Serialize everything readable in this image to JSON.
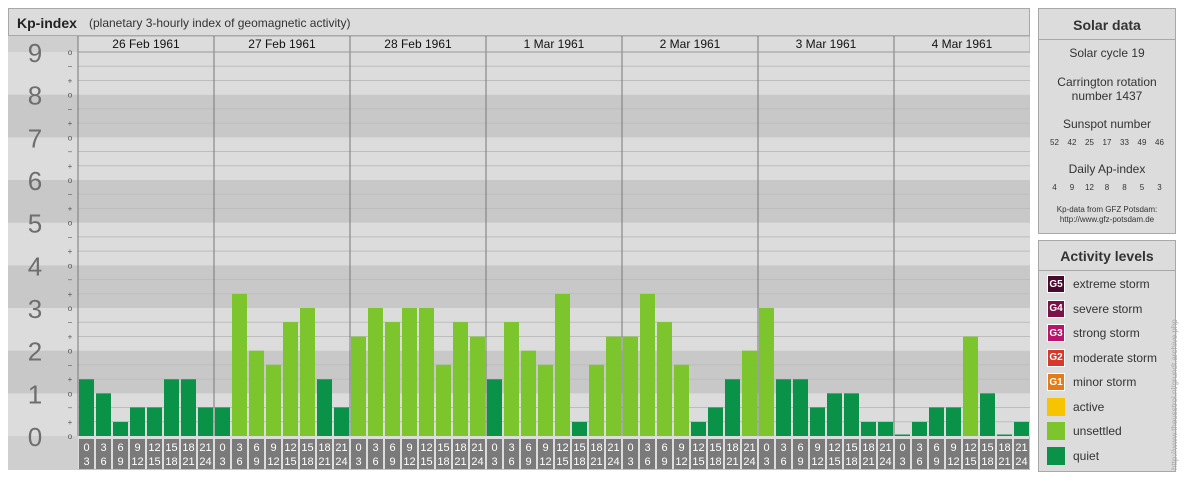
{
  "header": {
    "title": "Kp-index",
    "subtitle": "(planetary 3-hourly index of geomagnetic activity)"
  },
  "chart_data": {
    "type": "bar",
    "title": "Kp-index",
    "subtitle": "(planetary 3-hourly index of geomagnetic activity)",
    "ylim": [
      0,
      9
    ],
    "y_ticks": [
      "0",
      "1",
      "2",
      "3",
      "4",
      "5",
      "6",
      "7",
      "8",
      "9"
    ],
    "sub_ticks": [
      "+",
      "o",
      "−"
    ],
    "days": [
      "26 Feb 1961",
      "27 Feb 1961",
      "28 Feb 1961",
      "1 Mar 1961",
      "2 Mar 1961",
      "3 Mar 1961",
      "4 Mar 1961"
    ],
    "slots": [
      [
        "0",
        "3"
      ],
      [
        "3",
        "6"
      ],
      [
        "6",
        "9"
      ],
      [
        "9",
        "12"
      ],
      [
        "12",
        "15"
      ],
      [
        "15",
        "18"
      ],
      [
        "18",
        "21"
      ],
      [
        "21",
        "24"
      ]
    ],
    "values": [
      [
        1.33,
        1.0,
        0.33,
        0.67,
        0.67,
        1.33,
        1.33,
        0.67
      ],
      [
        0.67,
        3.33,
        2.0,
        1.67,
        2.67,
        3.0,
        1.33,
        0.67
      ],
      [
        2.33,
        3.0,
        2.67,
        3.0,
        3.0,
        1.67,
        2.67,
        2.33
      ],
      [
        1.33,
        2.67,
        2.0,
        1.67,
        3.33,
        0.33,
        1.67,
        2.33
      ],
      [
        2.33,
        3.33,
        2.67,
        1.67,
        0.33,
        0.67,
        1.33,
        2.0
      ],
      [
        3.0,
        1.33,
        1.33,
        0.67,
        1.0,
        1.0,
        0.33,
        0.33
      ],
      [
        0.0,
        0.33,
        0.67,
        0.67,
        2.33,
        1.0,
        0.0,
        0.33
      ]
    ],
    "grid": true,
    "colors": {
      "quiet": "#0a9348",
      "unsettled": "#7dc52d",
      "band_dark": "#c8c8c8",
      "band_light": "#dcdcdc",
      "divider": "#777777",
      "slot_label_bg": "#7a7a7a"
    }
  },
  "solar": {
    "heading": "Solar data",
    "cycle": "Solar cycle 19",
    "carrington_line1": "Carrington rotation",
    "carrington_line2": "number 1437",
    "sunspot_label": "Sunspot number",
    "sunspot_values": [
      "52",
      "42",
      "25",
      "17",
      "33",
      "49",
      "46"
    ],
    "ap_label": "Daily Ap-index",
    "ap_values": [
      "4",
      "9",
      "12",
      "8",
      "8",
      "5",
      "3"
    ],
    "credit_line1": "Kp-data from GFZ Potsdam:",
    "credit_line2": "http://www.gfz-potsdam.de"
  },
  "activity": {
    "heading": "Activity levels",
    "levels": [
      {
        "code": "G5",
        "label": "extreme storm",
        "color": "#4a0a2e"
      },
      {
        "code": "G4",
        "label": "severe storm",
        "color": "#7a1248"
      },
      {
        "code": "G3",
        "label": "strong storm",
        "color": "#b8146a"
      },
      {
        "code": "G2",
        "label": "moderate storm",
        "color": "#d6382a"
      },
      {
        "code": "G1",
        "label": "minor storm",
        "color": "#e57a18"
      },
      {
        "code": "",
        "label": "active",
        "color": "#f6c400"
      },
      {
        "code": "",
        "label": "unsettled",
        "color": "#7dc52d"
      },
      {
        "code": "",
        "label": "quiet",
        "color": "#0a9348"
      }
    ]
  },
  "watermark": "http://www.theusstrol.nl/grundt.archive.php"
}
